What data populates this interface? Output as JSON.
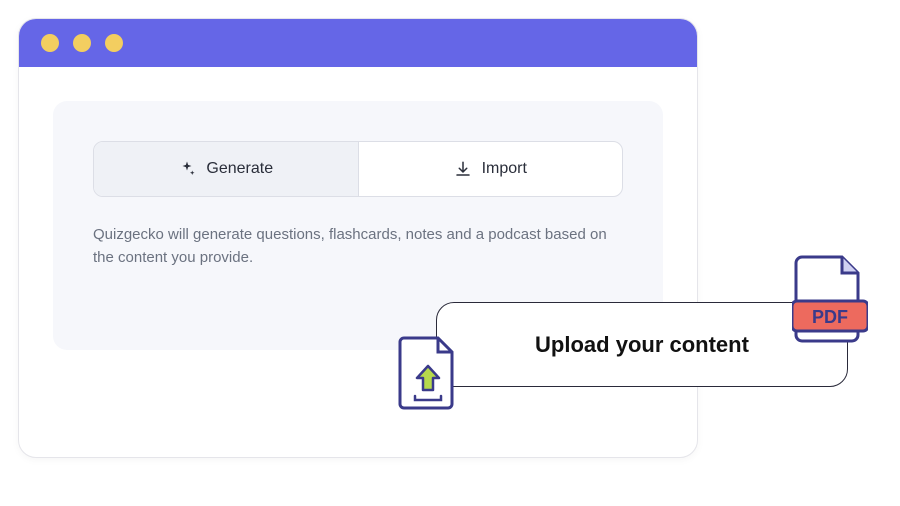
{
  "tabs": {
    "generate": {
      "label": "Generate"
    },
    "import": {
      "label": "Import"
    }
  },
  "description": "Quizgecko will generate questions, flashcards, notes and a podcast based on the content you provide.",
  "tooltip": {
    "label": "Upload your content"
  },
  "pdf": {
    "label": "PDF"
  },
  "colors": {
    "accent": "#6566e7",
    "dot": "#f3ce60",
    "pdfBadge": "#ed6a5e"
  }
}
